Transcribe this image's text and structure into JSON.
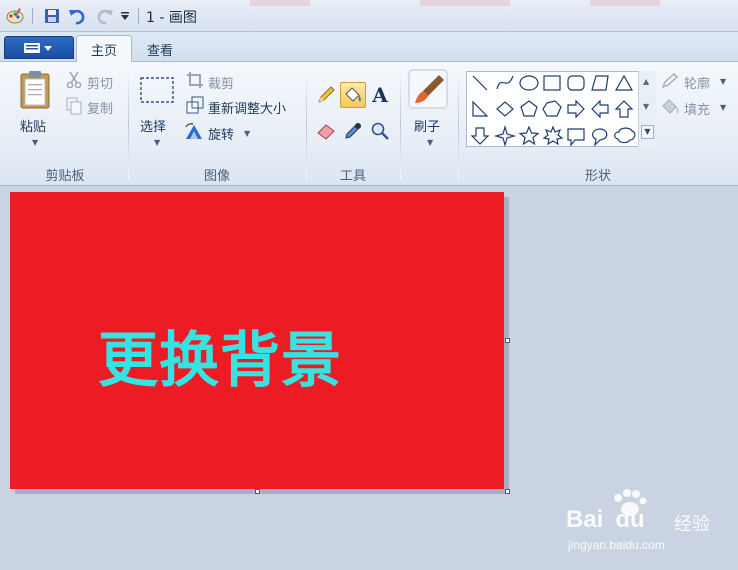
{
  "window": {
    "title": "1 - 画图"
  },
  "tabs": [
    {
      "label": "主页",
      "selected": true
    },
    {
      "label": "查看",
      "selected": false
    }
  ],
  "ribbon": {
    "clipboard": {
      "group_label": "剪贴板",
      "paste": "粘贴",
      "cut": "剪切",
      "copy": "复制"
    },
    "image": {
      "group_label": "图像",
      "select": "选择",
      "crop": "裁剪",
      "resize": "重新调整大小",
      "rotate": "旋转"
    },
    "tools": {
      "group_label": "工具"
    },
    "brushes": {
      "label": "刷子"
    },
    "shapes": {
      "group_label": "形状",
      "outline": "轮廓",
      "fill": "填充"
    }
  },
  "canvas": {
    "text": "更换背景",
    "background_color": "#ed1c24",
    "text_color": "#35e3e3"
  },
  "watermark": {
    "brand": "Bai",
    "brand2": "du",
    "product": "经验",
    "url": "jingyan.baidu.com"
  },
  "colors": {
    "accent": "#1a4fa3",
    "ribbon_bg": "#e6edf6",
    "work_bg": "#c9d3e2"
  }
}
